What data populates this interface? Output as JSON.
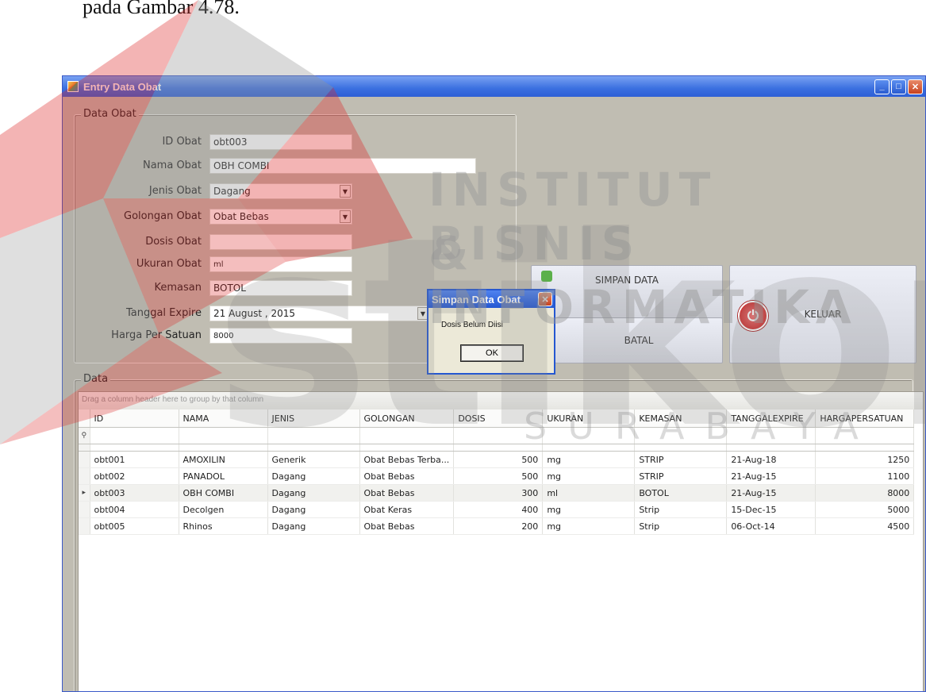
{
  "document": {
    "caption": "pada Gambar 4.78."
  },
  "watermark": {
    "line1": "INSTITUT BISNIS",
    "line2": "& INFORMATIKA",
    "big": "stikom",
    "city": "SURABAYA"
  },
  "window": {
    "title": "Entry Data Obat",
    "minimize": "_",
    "maximize": "□",
    "close": "✕"
  },
  "form": {
    "group_label": "Data Obat",
    "fields": [
      {
        "label": "ID Obat",
        "value": "obt003"
      },
      {
        "label": "Nama Obat",
        "value": "OBH COMBI"
      },
      {
        "label": "Jenis Obat",
        "value": "Dagang"
      },
      {
        "label": "Golongan Obat",
        "value": "Obat Bebas"
      },
      {
        "label": "Dosis Obat",
        "value": ""
      },
      {
        "label": "Ukuran Obat",
        "value": "ml"
      },
      {
        "label": "Kemasan",
        "value": "BOTOL"
      },
      {
        "label": "Tanggal Expire",
        "value": "21   August   , 2015"
      },
      {
        "label": "Harga Per Satuan",
        "value": "8000"
      }
    ]
  },
  "buttons": {
    "simpan": "SIMPAN DATA",
    "batal": "BATAL",
    "keluar": "KELUAR"
  },
  "grid": {
    "group_label": "Data",
    "groupbar_hint": "Drag a column header here to group by that column",
    "columns": [
      "ID",
      "NAMA",
      "JENIS",
      "GOLONGAN",
      "DOSIS",
      "UKURAN",
      "KEMASAN",
      "TANGGALEXPIRE",
      "HARGAPERSATUAN"
    ],
    "rows": [
      [
        "obt001",
        "AMOXILIN",
        "Generik",
        "Obat Bebas Terba...",
        "500",
        "mg",
        "STRIP",
        "21-Aug-18",
        "1250"
      ],
      [
        "obt002",
        "PANADOL",
        "Dagang",
        "Obat Bebas",
        "500",
        "mg",
        "STRIP",
        "21-Aug-15",
        "1100"
      ],
      [
        "obt003",
        "OBH COMBI",
        "Dagang",
        "Obat Bebas",
        "300",
        "ml",
        "BOTOL",
        "21-Aug-15",
        "8000"
      ],
      [
        "obt004",
        "Decolgen",
        "Dagang",
        "Obat Keras",
        "400",
        "mg",
        "Strip",
        "15-Dec-15",
        "5000"
      ],
      [
        "obt005",
        "Rhinos",
        "Dagang",
        "Obat Bebas",
        "200",
        "mg",
        "Strip",
        "06-Oct-14",
        "4500"
      ]
    ],
    "current_row_index": 2
  },
  "dialog": {
    "title": "Simpan Data Obat",
    "message": "Dosis Belum Diisi",
    "ok": "OK"
  }
}
